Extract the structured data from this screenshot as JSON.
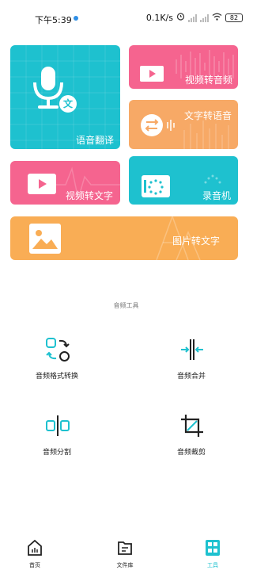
{
  "status_bar": {
    "time": "下午5:39",
    "network_speed": "0.1K/s",
    "battery": "82"
  },
  "cards": {
    "voice_translate": "语音翻译",
    "video_to_audio": "视频转音频",
    "text_to_speech": "文字转语音",
    "video_to_text": "视频转文字",
    "recorder": "录音机",
    "image_to_text": "图片转文字",
    "translate_badge": "文"
  },
  "audio_tools": {
    "title": "音频工具",
    "items": [
      {
        "label": "音频格式转换",
        "icon": "format-convert-icon"
      },
      {
        "label": "音频合并",
        "icon": "merge-icon"
      },
      {
        "label": "音频分割",
        "icon": "split-icon"
      },
      {
        "label": "音频裁剪",
        "icon": "crop-icon"
      }
    ]
  },
  "tabbar": {
    "items": [
      {
        "label": "首页",
        "icon": "home-icon"
      },
      {
        "label": "文件库",
        "icon": "folder-icon"
      },
      {
        "label": "工具",
        "icon": "tools-icon",
        "active": true
      }
    ]
  },
  "colors": {
    "teal": "#1ec1cf",
    "pink": "#f5648f",
    "orange": "#f7a966",
    "yellow_orange": "#f9ad55"
  }
}
